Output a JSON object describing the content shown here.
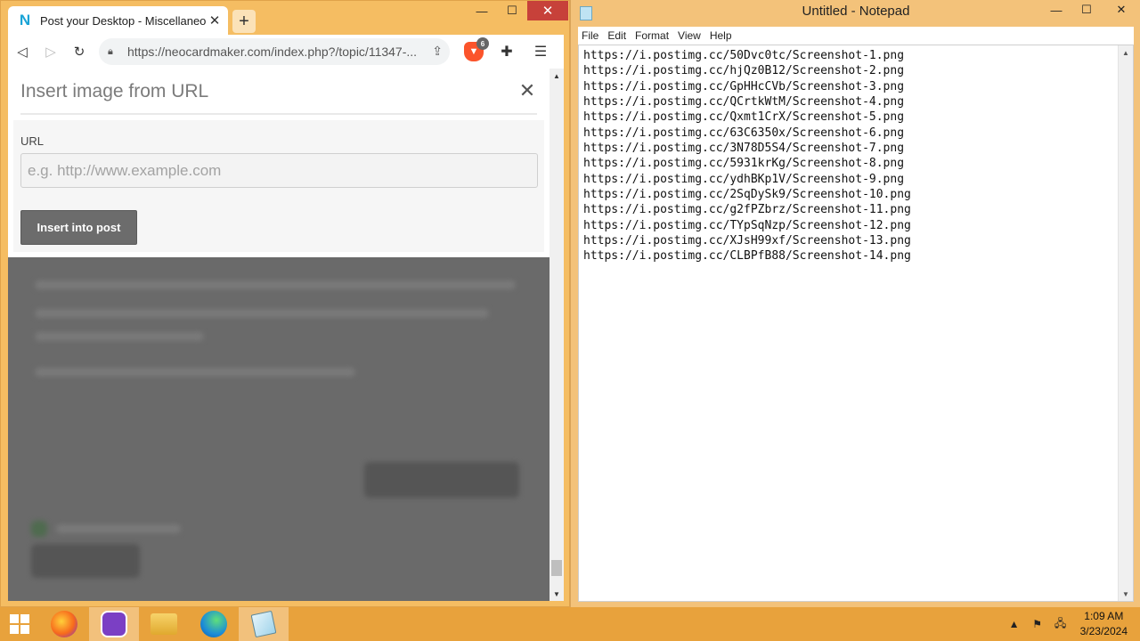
{
  "browser": {
    "tab_title": "Post your Desktop - Miscellaneous",
    "favicon_letter": "N",
    "url": "https://neocardmaker.com/index.php?/topic/11347-...",
    "brave_badge": "6",
    "icons": {
      "back": "back-arrow-icon",
      "forward": "forward-arrow-icon",
      "reload": "reload-icon",
      "lock": "lock-icon",
      "share": "share-icon",
      "extensions": "puzzle-icon",
      "menu": "hamburger-menu-icon"
    }
  },
  "modal": {
    "title": "Insert image from URL",
    "url_label": "URL",
    "url_placeholder": "e.g. http://www.example.com",
    "url_value": "",
    "insert_label": "Insert into post"
  },
  "notepad": {
    "title": "Untitled - Notepad",
    "menu": [
      "File",
      "Edit",
      "Format",
      "View",
      "Help"
    ],
    "lines": [
      "https://i.postimg.cc/50Dvc0tc/Screenshot-1.png",
      "https://i.postimg.cc/hjQz0B12/Screenshot-2.png",
      "https://i.postimg.cc/GpHHcCVb/Screenshot-3.png",
      "https://i.postimg.cc/QCrtkWtM/Screenshot-4.png",
      "https://i.postimg.cc/Qxmt1CrX/Screenshot-5.png",
      "https://i.postimg.cc/63C6350x/Screenshot-6.png",
      "https://i.postimg.cc/3N78D5S4/Screenshot-7.png",
      "https://i.postimg.cc/5931krKg/Screenshot-8.png",
      "https://i.postimg.cc/ydhBKp1V/Screenshot-9.png",
      "https://i.postimg.cc/2SqDySk9/Screenshot-10.png",
      "https://i.postimg.cc/g2fPZbrz/Screenshot-11.png",
      "https://i.postimg.cc/TYpSqNzp/Screenshot-12.png",
      "https://i.postimg.cc/XJsH99xf/Screenshot-13.png",
      "https://i.postimg.cc/CLBPfB88/Screenshot-14.png"
    ]
  },
  "taskbar": {
    "apps": [
      {
        "name": "firefox-icon",
        "color": "#e66000"
      },
      {
        "name": "brave-nightly-icon",
        "color": "#7b3fc4"
      },
      {
        "name": "file-explorer-icon",
        "color": "#f0c24a"
      },
      {
        "name": "edge-icon",
        "color": "#1c8cd8"
      },
      {
        "name": "notepad-icon",
        "color": "#9fd3ea"
      }
    ],
    "time": "1:09 AM",
    "date": "3/23/2024"
  },
  "colors": {
    "window_frame": "#f5bd62",
    "taskbar": "#e8a23c",
    "close_button": "#c7413a",
    "insert_button": "#6c6c6c"
  }
}
